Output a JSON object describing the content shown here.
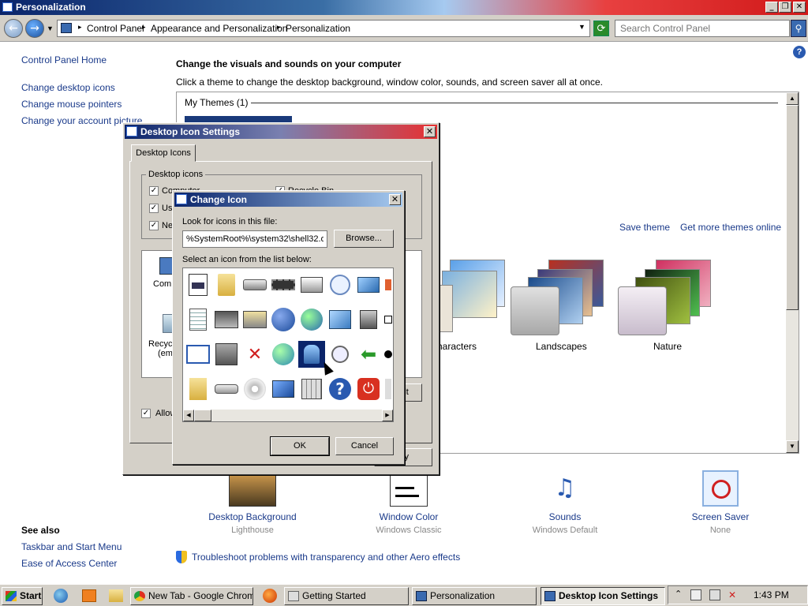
{
  "window": {
    "title": "Personalization",
    "controls": {
      "minimize": "_",
      "maximize": "❐",
      "close": "✕"
    }
  },
  "navbar": {
    "crumbs": [
      "Control Panel",
      "Appearance and Personalization",
      "Personalization"
    ],
    "search_placeholder": "Search Control Panel"
  },
  "left_pane": {
    "home": "Control Panel Home",
    "links": [
      "Change desktop icons",
      "Change mouse pointers",
      "Change your account picture"
    ],
    "see_also_heading": "See also",
    "see_also": [
      "Taskbar and Start Menu",
      "Ease of Access Center"
    ]
  },
  "main": {
    "heading": "Change the visuals and sounds on your computer",
    "subheading": "Click a theme to change the desktop background, window color, sounds, and screen saver all at once.",
    "my_themes": "My Themes (1)",
    "save_theme": "Save theme",
    "more_themes": "Get more themes online",
    "themes": [
      "Characters",
      "Landscapes",
      "Nature"
    ],
    "characters_visible": "haracters",
    "troubleshoot": "Troubleshoot problems with transparency and other Aero effects"
  },
  "bottom_items": [
    {
      "label": "Desktop Background",
      "sub": "Lighthouse"
    },
    {
      "label": "Window Color",
      "sub": "Windows Classic"
    },
    {
      "label": "Sounds",
      "sub": "Windows Default"
    },
    {
      "label": "Screen Saver",
      "sub": "None"
    }
  ],
  "desktop_icon_dialog": {
    "title": "Desktop Icon Settings",
    "tab": "Desktop Icons",
    "group": "Desktop icons",
    "checks": [
      "Computer",
      "Us",
      "Ne",
      "Recycle Bin"
    ],
    "preview_labels": [
      "Comp",
      "Recycl",
      "(emp"
    ],
    "allow": "Allow",
    "default_btn": "ault",
    "apply_btn": "ply"
  },
  "change_icon_dialog": {
    "title": "Change Icon",
    "look_label": "Look for icons in this file:",
    "file_path": "%SystemRoot%\\system32\\shell32.d",
    "browse": "Browse...",
    "select_label": "Select an icon from the list below:",
    "ok": "OK",
    "cancel": "Cancel"
  },
  "taskbar": {
    "start": "Start",
    "tasks": [
      "New Tab - Google Chrome",
      "Getting Started",
      "Personalization",
      "Desktop Icon Settings"
    ],
    "clock": "1:43 PM"
  },
  "colors": {
    "link": "#1a3a8a",
    "dialog_title_start": "#0a246a",
    "dialog_title_end": "#e83030",
    "selected_icon_bg": "#0a246a"
  }
}
